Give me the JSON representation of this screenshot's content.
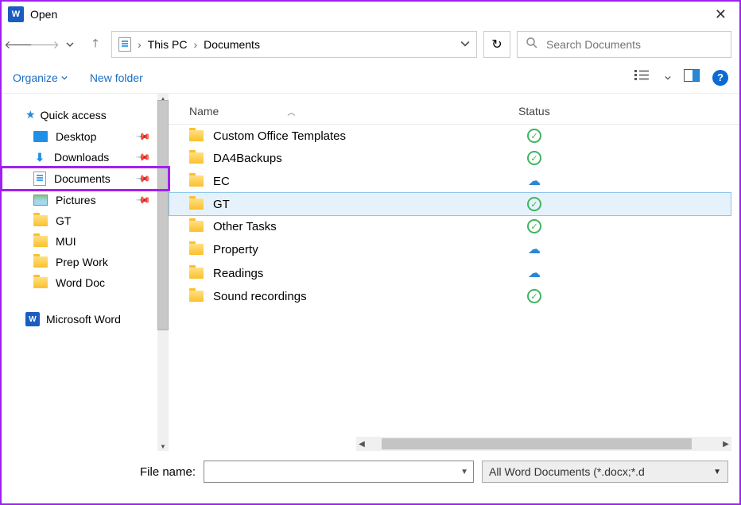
{
  "window": {
    "title": "Open"
  },
  "breadcrumb": {
    "root": "This PC",
    "current": "Documents"
  },
  "search": {
    "placeholder": "Search Documents"
  },
  "toolbar": {
    "organize": "Organize",
    "newfolder": "New folder"
  },
  "sidebar": {
    "quick_access": "Quick access",
    "items": [
      {
        "label": "Desktop",
        "icon": "desktop",
        "pinned": true
      },
      {
        "label": "Downloads",
        "icon": "download",
        "pinned": true
      },
      {
        "label": "Documents",
        "icon": "docs",
        "pinned": true,
        "highlighted": true
      },
      {
        "label": "Pictures",
        "icon": "pics",
        "pinned": true
      },
      {
        "label": "GT",
        "icon": "folder",
        "pinned": false
      },
      {
        "label": "MUI",
        "icon": "folder",
        "pinned": false
      },
      {
        "label": "Prep Work",
        "icon": "folder",
        "pinned": false
      },
      {
        "label": "Word Doc",
        "icon": "folder",
        "pinned": false
      }
    ],
    "msword": "Microsoft Word"
  },
  "columns": {
    "name": "Name",
    "status": "Status"
  },
  "files": [
    {
      "name": "Custom Office Templates",
      "status": "ok"
    },
    {
      "name": "DA4Backups",
      "status": "ok"
    },
    {
      "name": "EC",
      "status": "cloud"
    },
    {
      "name": "GT",
      "status": "ok",
      "selected": true
    },
    {
      "name": "Other Tasks",
      "status": "ok"
    },
    {
      "name": "Property",
      "status": "cloud"
    },
    {
      "name": "Readings",
      "status": "cloud"
    },
    {
      "name": "Sound recordings",
      "status": "ok"
    }
  ],
  "bottom": {
    "filename_label": "File name:",
    "filetype": "All Word Documents (*.docx;*.d"
  }
}
